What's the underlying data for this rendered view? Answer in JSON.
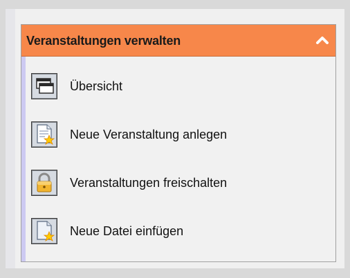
{
  "panel": {
    "title": "Veranstaltungen verwalten",
    "collapse_icon": "chevron-up-icon",
    "header_color": "#f7874a"
  },
  "items": [
    {
      "label": "Übersicht",
      "icon": "windows-icon"
    },
    {
      "label": "Neue Veranstaltung anlegen",
      "icon": "new-document-icon"
    },
    {
      "label": "Veranstaltungen freischalten",
      "icon": "lock-icon"
    },
    {
      "label": "Neue Datei einfügen",
      "icon": "new-file-icon"
    }
  ]
}
